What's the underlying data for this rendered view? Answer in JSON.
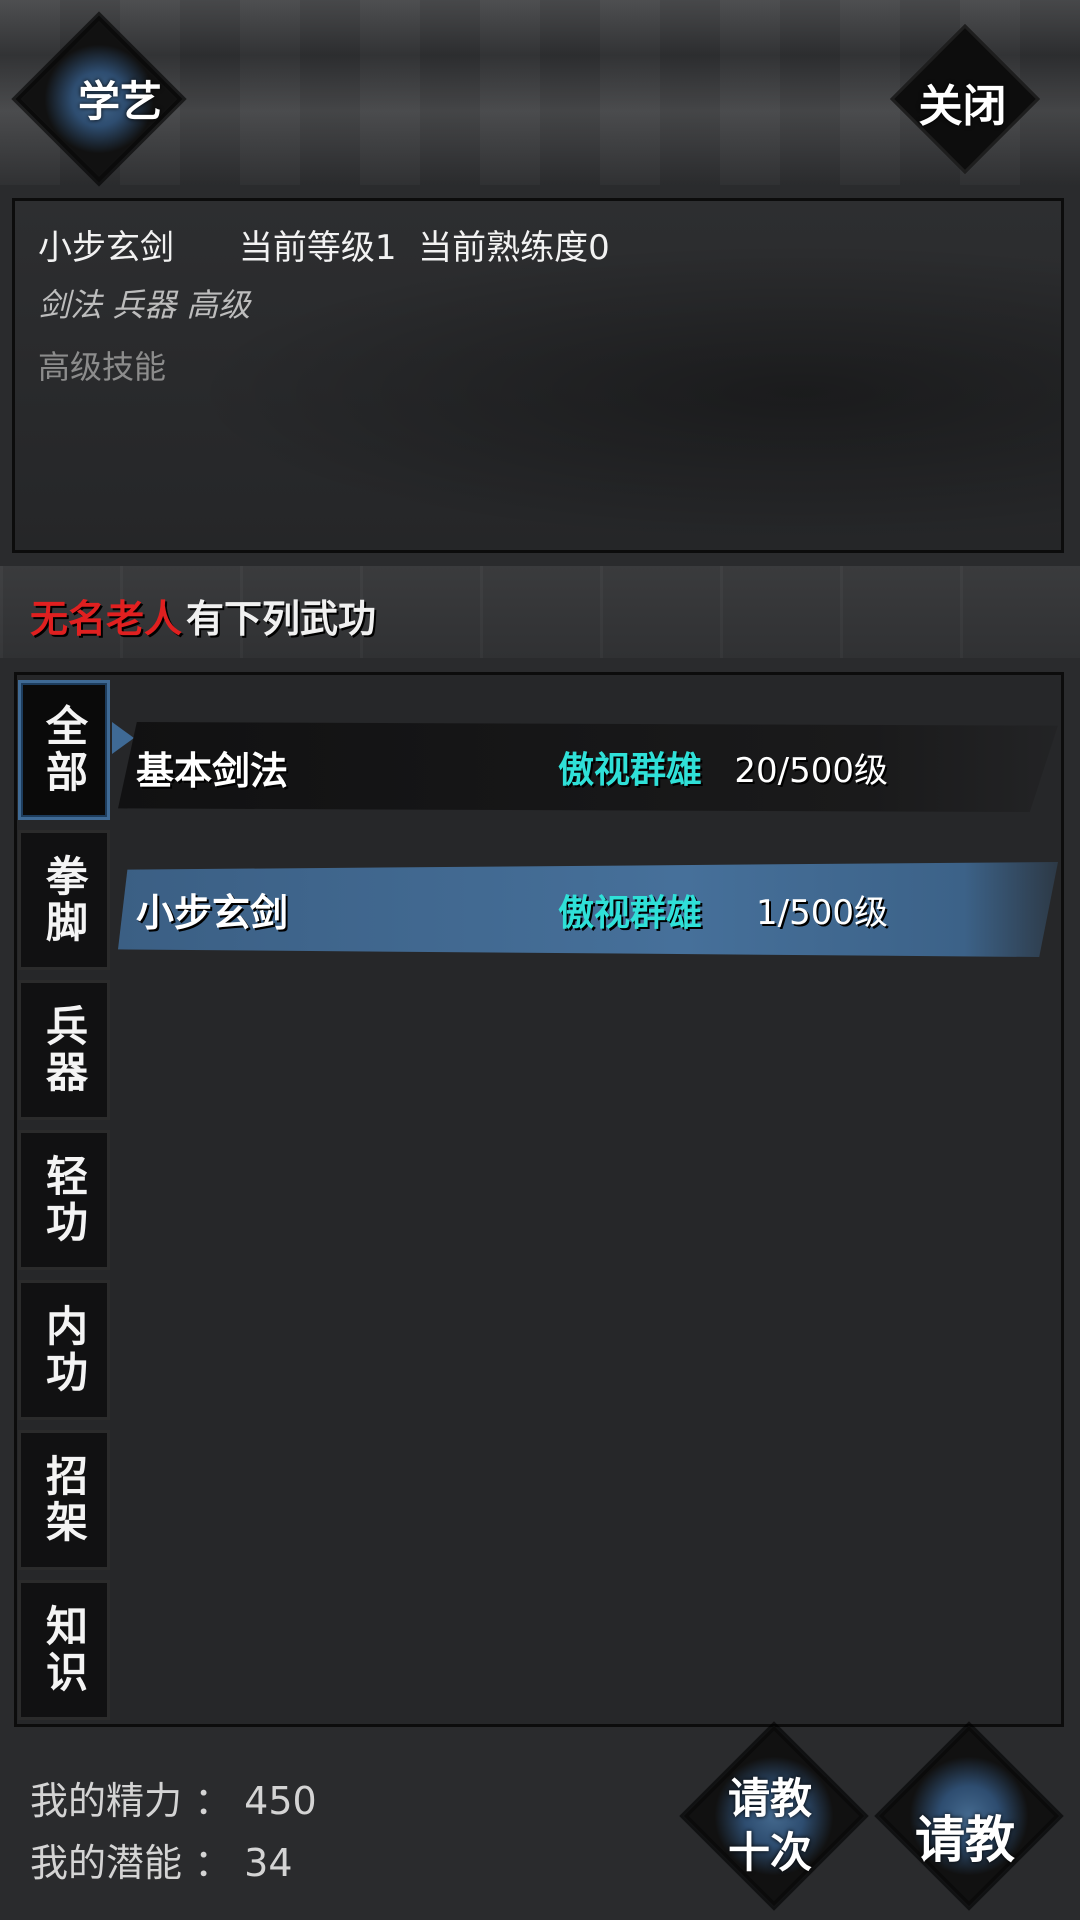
{
  "header": {
    "learn_label": "学艺",
    "close_label": "关闭"
  },
  "skill_info": {
    "title": "小步玄剑      当前等级1  当前熟练度0",
    "tags": "剑法 兵器 高级",
    "description": "高级技能"
  },
  "teacher": {
    "name": "无名老人",
    "suffix": "有下列武功"
  },
  "tabs": [
    {
      "label": "全部",
      "active": true
    },
    {
      "label": "拳脚",
      "active": false
    },
    {
      "label": "兵器",
      "active": false
    },
    {
      "label": "轻功",
      "active": false
    },
    {
      "label": "内功",
      "active": false
    },
    {
      "label": "招架",
      "active": false
    },
    {
      "label": "知识",
      "active": false
    }
  ],
  "skills": [
    {
      "name": "基本剑法",
      "tier": "傲视群雄",
      "level": "20/500级",
      "selected": false
    },
    {
      "name": "小步玄剑",
      "tier": "傲视群雄",
      "level": "1/500级",
      "selected": true
    }
  ],
  "stats": {
    "energy": "我的精力 ： 450",
    "potential": "我的潜能 ： 34"
  },
  "actions": {
    "ask_ten_line1": "请教",
    "ask_ten_line2": "十次",
    "ask_label": "请教"
  },
  "colors": {
    "accent_blue": "#3f6a95",
    "teacher_red": "#e02020",
    "tier_cyan": "#2fe0d8"
  }
}
